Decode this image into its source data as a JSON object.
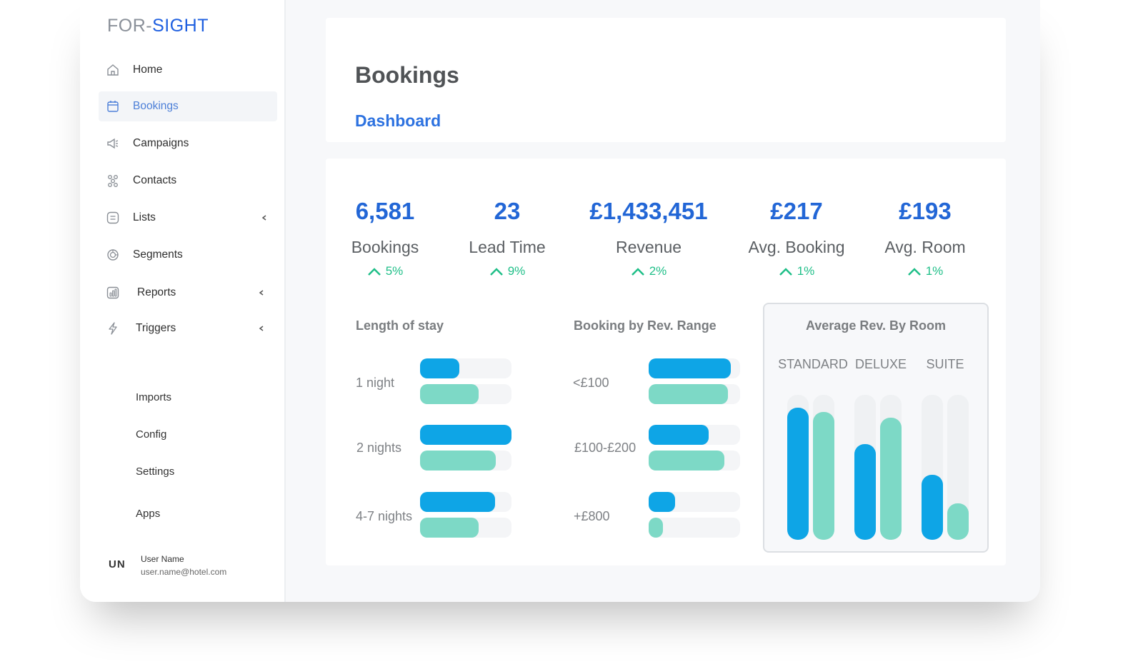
{
  "brand": {
    "part1": "FOR-",
    "part2": "SIGHT"
  },
  "sidebar": {
    "items": [
      {
        "label": "Home",
        "icon": "home-icon"
      },
      {
        "label": "Bookings",
        "icon": "calendar-icon",
        "active": true
      },
      {
        "label": "Campaigns",
        "icon": "megaphone-icon"
      },
      {
        "label": "Contacts",
        "icon": "contacts-icon"
      },
      {
        "label": "Lists",
        "icon": "list-icon",
        "chevron": true
      },
      {
        "label": "Segments",
        "icon": "segments-icon"
      },
      {
        "label": "Reports",
        "icon": "reports-icon",
        "chevron": true
      },
      {
        "label": "Triggers",
        "icon": "lightning-icon",
        "chevron": true
      }
    ],
    "sub_items": [
      "Imports",
      "Config",
      "Settings",
      "Apps"
    ],
    "user": {
      "initials": "UN",
      "name": "User Name",
      "email": "user.name@hotel.com"
    }
  },
  "header": {
    "title": "Bookings",
    "subtitle": "Dashboard"
  },
  "kpis": [
    {
      "value": "6,581",
      "label": "Bookings",
      "change": "5%"
    },
    {
      "value": "23",
      "label": "Lead Time",
      "change": "9%"
    },
    {
      "value": "£1,433,451",
      "label": "Revenue",
      "change": "2%"
    },
    {
      "value": "£217",
      "label": "Avg. Booking",
      "change": "1%"
    },
    {
      "value": "£193",
      "label": "Avg. Room",
      "change": "1%"
    }
  ],
  "colors": {
    "series_a": "#0ea5e6",
    "series_b": "#7dd9c6",
    "track": "#f4f5f7",
    "accent": "#2266d6",
    "positive": "#1fbf88"
  },
  "chart_data": [
    {
      "type": "bar",
      "title": "Length of stay",
      "categories": [
        "1 night",
        "2 nights",
        "4-7 nights"
      ],
      "series": [
        {
          "values": [
            0.43,
            1.0,
            0.82
          ]
        },
        {
          "values": [
            0.64,
            0.83,
            0.64
          ]
        }
      ],
      "ylim": [
        0,
        1
      ]
    },
    {
      "type": "bar",
      "title": "Booking by Rev. Range",
      "categories": [
        "<£100",
        "£100-£200",
        "+£800"
      ],
      "series": [
        {
          "values": [
            0.9,
            0.66,
            0.29
          ]
        },
        {
          "values": [
            0.87,
            0.83,
            0.16
          ]
        }
      ],
      "ylim": [
        0,
        1
      ]
    },
    {
      "type": "bar",
      "title": "Average Rev. By Room",
      "categories": [
        "STANDARD",
        "DELUXE",
        "SUITE"
      ],
      "series": [
        {
          "values": [
            0.91,
            0.66,
            0.45
          ]
        },
        {
          "values": [
            0.88,
            0.84,
            0.25
          ]
        }
      ],
      "ylim": [
        0,
        1
      ]
    }
  ]
}
